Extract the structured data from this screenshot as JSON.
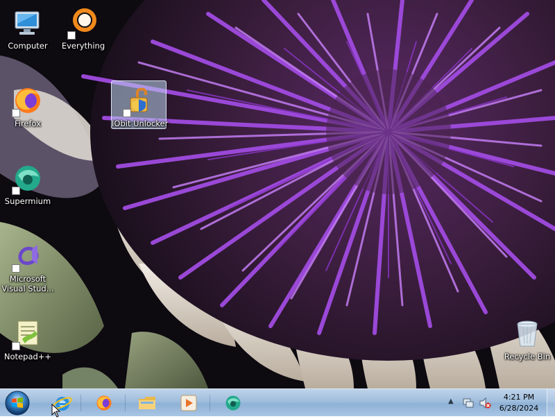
{
  "desktop": {
    "icons": [
      {
        "label": "Computer",
        "icon": "computer-icon"
      },
      {
        "label": "Everything",
        "icon": "everything-search-icon"
      },
      {
        "label": "Firefox",
        "icon": "firefox-icon"
      },
      {
        "label": "IObit Unlocker",
        "icon": "iobit-unlocker-icon"
      },
      {
        "label": "Supermium",
        "icon": "supermium-icon"
      },
      {
        "label": "Microsoft Visual Stud...",
        "icon": "visual-studio-icon"
      },
      {
        "label": "Notepad++",
        "icon": "notepadplusplus-icon"
      },
      {
        "label": "Recycle Bin",
        "icon": "recycle-bin-icon"
      }
    ]
  },
  "taskbar": {
    "pinned": [
      {
        "name": "Internet Explorer",
        "icon": "internet-explorer-icon"
      },
      {
        "name": "Firefox",
        "icon": "firefox-icon"
      },
      {
        "name": "File Explorer",
        "icon": "folder-icon"
      },
      {
        "name": "Media Player",
        "icon": "media-player-icon"
      },
      {
        "name": "Supermium",
        "icon": "supermium-icon"
      }
    ],
    "clock": {
      "time": "4:21 PM",
      "date": "6/28/2024"
    }
  },
  "colors": {
    "accent": "#9b3fd8",
    "taskbar": "#a9c6e4"
  }
}
